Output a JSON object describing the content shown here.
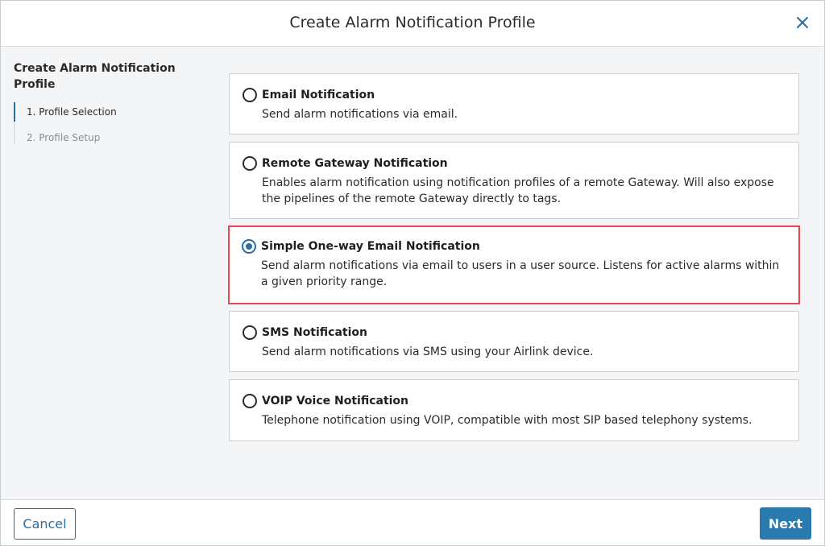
{
  "dialog": {
    "title": "Create Alarm Notification Profile",
    "close_icon": "close-icon",
    "accent_color": "#2a6ea3",
    "selected_border_color": "#e8474f"
  },
  "sidebar": {
    "title": "Create Alarm Notification Profile",
    "steps": [
      {
        "label": "1. Profile Selection",
        "active": true
      },
      {
        "label": "2. Profile Setup",
        "active": false
      }
    ]
  },
  "options": [
    {
      "title": "Email Notification",
      "description": "Send alarm notifications via email.",
      "selected": false
    },
    {
      "title": "Remote Gateway Notification",
      "description": "Enables alarm notification using notification profiles of a remote Gateway. Will also expose the pipelines of the remote Gateway directly to tags.",
      "selected": false
    },
    {
      "title": "Simple One-way Email Notification",
      "description": "Send alarm notifications via email to users in a user source. Listens for active alarms within a given priority range.",
      "selected": true
    },
    {
      "title": "SMS Notification",
      "description": "Send alarm notifications via SMS using your Airlink device.",
      "selected": false
    },
    {
      "title": "VOIP Voice Notification",
      "description": "Telephone notification using VOIP, compatible with most SIP based telephony systems.",
      "selected": false
    }
  ],
  "footer": {
    "cancel_label": "Cancel",
    "next_label": "Next"
  }
}
